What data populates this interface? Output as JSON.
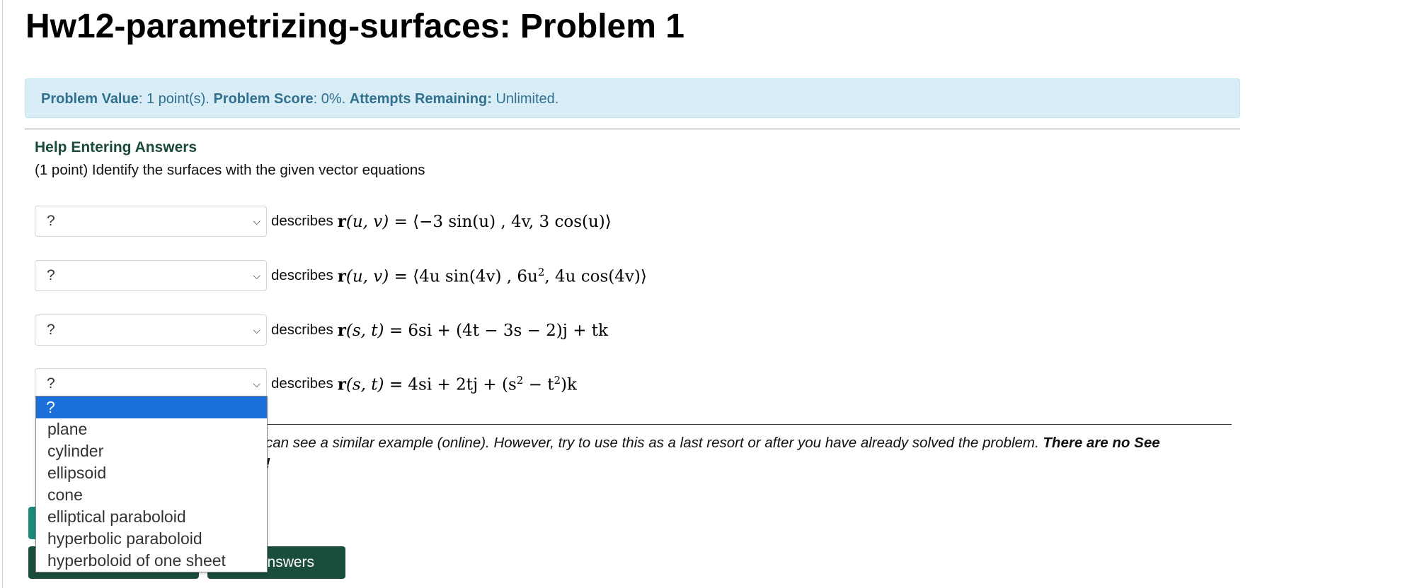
{
  "page": {
    "title": "Hw12-parametrizing-surfaces: Problem 1"
  },
  "info": {
    "value_label": "Problem Value",
    "value_text": ": 1 point(s). ",
    "score_label": "Problem Score",
    "score_text": ": 0%. ",
    "attempts_label": "Attempts Remaining:",
    "attempts_text": " Unlimited."
  },
  "help": {
    "link_text": "Help Entering Answers"
  },
  "problem": {
    "prompt": "(1 point) Identify the surfaces with the given vector equations",
    "describes_label": "describes",
    "rows": [
      {
        "selected": "?",
        "func": "r",
        "vars": "(u, v)",
        "rhs": "= ⟨−3 sin(u) , 4v, 3 cos(u)⟩"
      },
      {
        "selected": "?",
        "func": "r",
        "vars": "(u, v)",
        "rhs_a": "= ⟨4u sin(4v) , 6u",
        "rhs_sup": "2",
        "rhs_b": ", 4u cos(4v)⟩"
      },
      {
        "selected": "?",
        "func": "r",
        "vars": "(s, t)",
        "rhs": "= 6si + (4t − 3s − 2)j + tk"
      },
      {
        "selected": "?",
        "func": "r",
        "vars": "(s, t)",
        "rhs_a": "= 4si + 2tj + (s",
        "rhs_sup1": "2",
        "rhs_b": " − t",
        "rhs_sup2": "2",
        "rhs_c": ")k"
      }
    ]
  },
  "dropdown": {
    "options": [
      "?",
      "plane",
      "cylinder",
      "ellipsoid",
      "cone",
      "elliptical paraboloid",
      "hyperbolic paraboloid",
      "hyperboloid of one sheet"
    ],
    "selected_index": 0
  },
  "note": {
    "line1": "can see a similar example (online). However, try to use this as a last resort or after you have already solved the problem. ",
    "line1_bold": "There are no See",
    "line2": "!"
  },
  "buttons": {
    "right_label": "t Answers"
  },
  "colors": {
    "info_bg": "#d9edf7",
    "info_text": "#31708f",
    "button_dark": "#1b4d3e",
    "button_teal": "#1b8a7a",
    "dropdown_selected": "#1a6fd8"
  }
}
